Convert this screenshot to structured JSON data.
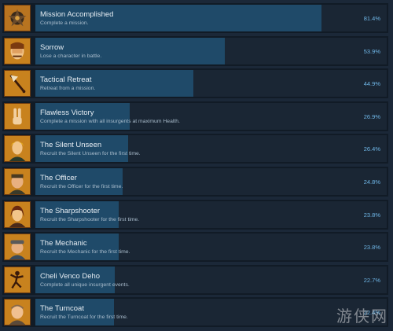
{
  "achievements": [
    {
      "name": "Mission Accomplished",
      "desc": "Complete a mission.",
      "pct": "81.4%",
      "fraction": 0.814,
      "icon": "mission-medal-icon"
    },
    {
      "name": "Sorrow",
      "desc": "Lose a character in battle.",
      "pct": "53.9%",
      "fraction": 0.539,
      "icon": "grieving-face-icon"
    },
    {
      "name": "Tactical Retreat",
      "desc": "Retreat from a mission.",
      "pct": "44.9%",
      "fraction": 0.449,
      "icon": "retreat-flag-icon"
    },
    {
      "name": "Flawless Victory",
      "desc": "Complete a mission with all insurgents at maximum Health.",
      "pct": "26.9%",
      "fraction": 0.269,
      "icon": "victory-hand-icon"
    },
    {
      "name": "The Silent Unseen",
      "desc": "Recruit the Silent Unseen for the first time.",
      "pct": "26.4%",
      "fraction": 0.264,
      "icon": "silent-unseen-portrait-icon"
    },
    {
      "name": "The Officer",
      "desc": "Recruit the Officer for the first time.",
      "pct": "24.8%",
      "fraction": 0.248,
      "icon": "officer-portrait-icon"
    },
    {
      "name": "The Sharpshooter",
      "desc": "Recruit the Sharpshooter for the first time.",
      "pct": "23.8%",
      "fraction": 0.238,
      "icon": "sharpshooter-portrait-icon"
    },
    {
      "name": "The Mechanic",
      "desc": "Recruit the Mechanic for the first time.",
      "pct": "23.8%",
      "fraction": 0.238,
      "icon": "mechanic-portrait-icon"
    },
    {
      "name": "Cheli Venco Deho",
      "desc": "Complete all unique insurgent events.",
      "pct": "22.7%",
      "fraction": 0.227,
      "icon": "dancing-figure-icon"
    },
    {
      "name": "The Turncoat",
      "desc": "Recruit the Turncoat for the first time.",
      "pct": "22.4%",
      "fraction": 0.224,
      "icon": "turncoat-portrait-icon"
    }
  ],
  "watermark": "游侠网",
  "colors": {
    "background": "#1b2838",
    "bar_fill": "#1f4a69",
    "percent_text": "#6fb6e6",
    "icon_bg": "#c8821e"
  }
}
